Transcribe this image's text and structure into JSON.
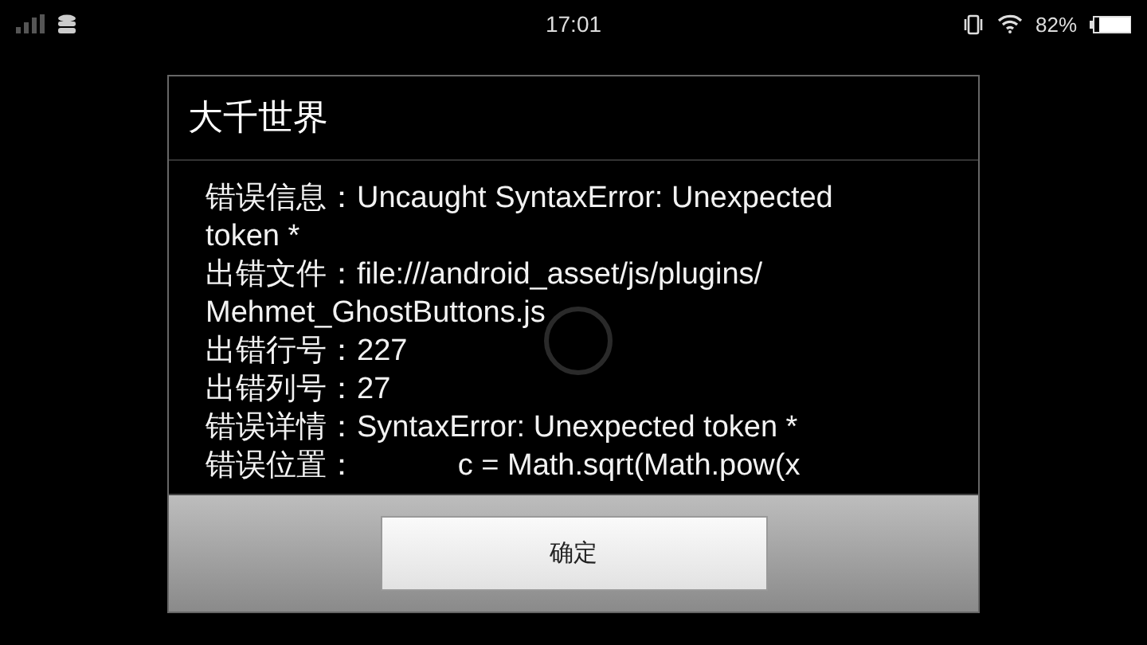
{
  "status_bar": {
    "time": "17:01",
    "battery_text": "82%"
  },
  "dialog": {
    "title": "大千世界",
    "entries": [
      {
        "label": "错误信息：",
        "value": "Uncaught SyntaxError: Unexpected token *"
      },
      {
        "label": "出错文件：",
        "value": "file:///android_asset/js/plugins/ Mehmet_GhostButtons.js"
      },
      {
        "label": "出错行号：",
        "value": "227"
      },
      {
        "label": "出错列号：",
        "value": "27"
      },
      {
        "label": "错误详情：",
        "value": "SyntaxError: Unexpected token *"
      },
      {
        "label": "错误位置：",
        "value": "            c = Math.sqrt(Math.pow(x"
      }
    ],
    "button": "确定"
  }
}
